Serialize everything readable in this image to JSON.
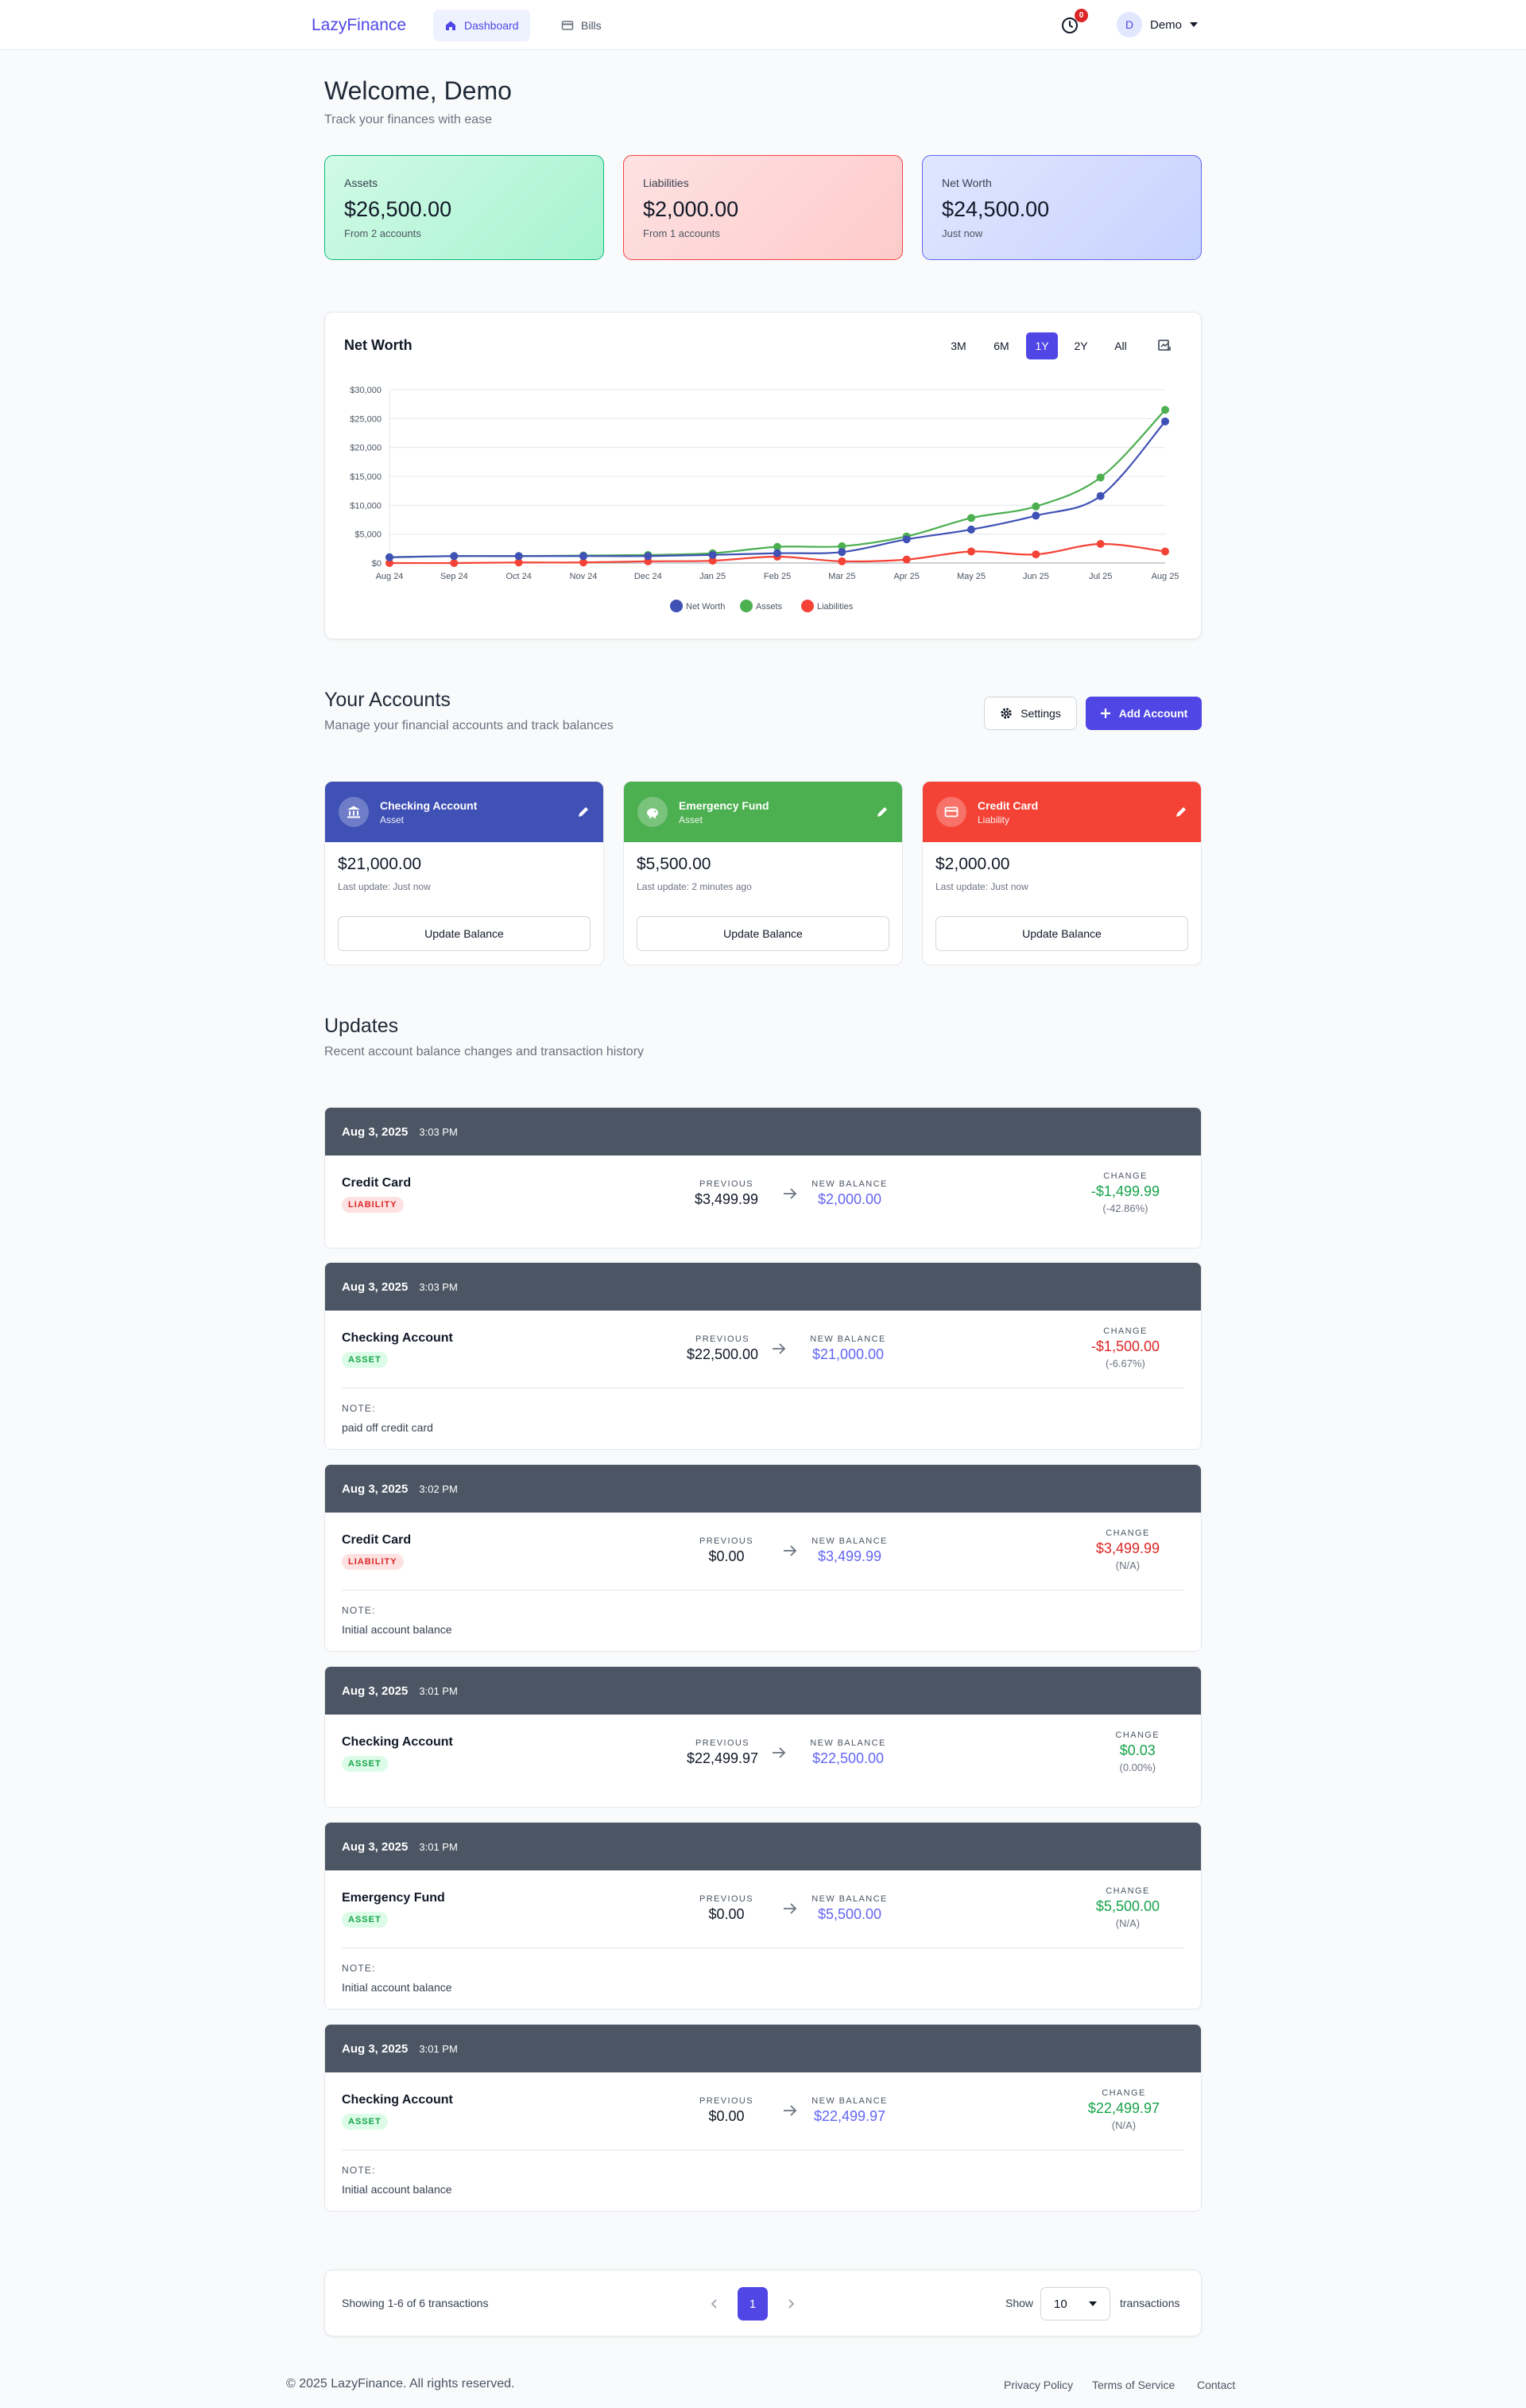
{
  "nav": {
    "logo": "LazyFinance",
    "links": [
      {
        "label": "Dashboard",
        "active": true
      },
      {
        "label": "Bills",
        "active": false
      }
    ],
    "notification_count": "0",
    "user_initial": "D",
    "user_name": "Demo"
  },
  "header": {
    "title": "Welcome, Demo",
    "subtitle": "Track your finances with ease"
  },
  "stats": [
    {
      "label": "Assets",
      "value": "$26,500.00",
      "hint": "From 2 accounts",
      "color": "#10b981"
    },
    {
      "label": "Liabilities",
      "value": "$2,000.00",
      "hint": "From 1 accounts",
      "color": "#ef4444"
    },
    {
      "label": "Net Worth",
      "value": "$24,500.00",
      "hint": "Just now",
      "color": "#6366f1"
    }
  ],
  "chart": {
    "title": "Net Worth",
    "ranges": [
      "3M",
      "6M",
      "1Y",
      "2Y",
      "All"
    ],
    "selected_range": "1Y"
  },
  "chart_data": {
    "type": "line",
    "title": "Net Worth",
    "categories": [
      "Aug 24",
      "Sep 24",
      "Oct 24",
      "Nov 24",
      "Dec 24",
      "Jan 25",
      "Feb 25",
      "Mar 25",
      "Apr 25",
      "May 25",
      "Jun 25",
      "Jul 25",
      "Aug 25"
    ],
    "ylim": [
      0,
      30000
    ],
    "yticks": [
      "$0",
      "$5,000",
      "$10,000",
      "$15,000",
      "$20,000",
      "$25,000",
      "$30,000"
    ],
    "grid": true,
    "legend_position": "bottom",
    "series": [
      {
        "name": "Net Worth",
        "color": "#3f51b5",
        "values": [
          1000,
          1200,
          1200,
          1200,
          1200,
          1400,
          1700,
          1900,
          4100,
          5800,
          8200,
          11600,
          24500
        ]
      },
      {
        "name": "Assets",
        "color": "#4caf50",
        "values": [
          1000,
          1200,
          1200,
          1300,
          1400,
          1700,
          2800,
          2900,
          4600,
          7800,
          9800,
          14800,
          26500
        ]
      },
      {
        "name": "Liabilities",
        "color": "#f44336",
        "values": [
          0,
          0,
          100,
          100,
          300,
          400,
          1100,
          300,
          600,
          2000,
          1500,
          3300,
          2000
        ]
      }
    ]
  },
  "accounts_section": {
    "title": "Your Accounts",
    "subtitle": "Manage your financial accounts and track balances",
    "settings_label": "Settings",
    "add_label": "Add Account"
  },
  "accounts": [
    {
      "name": "Checking Account",
      "type": "Asset",
      "balance": "$21,000.00",
      "last_update": "Last update: Just now",
      "button": "Update Balance",
      "color": "#3f51b5",
      "icon": "bank-icon"
    },
    {
      "name": "Emergency Fund",
      "type": "Asset",
      "balance": "$5,500.00",
      "last_update": "Last update: 2 minutes ago",
      "button": "Update Balance",
      "color": "#4caf50",
      "icon": "piggy-bank-icon"
    },
    {
      "name": "Credit Card",
      "type": "Liability",
      "balance": "$2,000.00",
      "last_update": "Last update: Just now",
      "button": "Update Balance",
      "color": "#f44336",
      "icon": "credit-card-icon"
    }
  ],
  "updates_section": {
    "title": "Updates",
    "subtitle": "Recent account balance changes and transaction history",
    "previous_label": "PREVIOUS",
    "new_label": "NEW BALANCE",
    "change_label": "CHANGE",
    "note_label": "NOTE:"
  },
  "updates": [
    {
      "date": "Aug 3, 2025",
      "time": "3:03 PM",
      "account": "Credit Card",
      "kind": "LIABILITY",
      "previous": "$3,499.99",
      "new_balance": "$2,000.00",
      "change": "-$1,499.99",
      "percent": "(-42.86%)",
      "change_dir": "pos",
      "note": ""
    },
    {
      "date": "Aug 3, 2025",
      "time": "3:03 PM",
      "account": "Checking Account",
      "kind": "ASSET",
      "previous": "$22,500.00",
      "new_balance": "$21,000.00",
      "change": "-$1,500.00",
      "percent": "(-6.67%)",
      "change_dir": "neg",
      "note": "paid off credit card"
    },
    {
      "date": "Aug 3, 2025",
      "time": "3:02 PM",
      "account": "Credit Card",
      "kind": "LIABILITY",
      "previous": "$0.00",
      "new_balance": "$3,499.99",
      "change": "$3,499.99",
      "percent": "(N/A)",
      "change_dir": "neg",
      "note": "Initial account balance"
    },
    {
      "date": "Aug 3, 2025",
      "time": "3:01 PM",
      "account": "Checking Account",
      "kind": "ASSET",
      "previous": "$22,499.97",
      "new_balance": "$22,500.00",
      "change": "$0.03",
      "percent": "(0.00%)",
      "change_dir": "pos",
      "note": ""
    },
    {
      "date": "Aug 3, 2025",
      "time": "3:01 PM",
      "account": "Emergency Fund",
      "kind": "ASSET",
      "previous": "$0.00",
      "new_balance": "$5,500.00",
      "change": "$5,500.00",
      "percent": "(N/A)",
      "change_dir": "pos",
      "note": "Initial account balance"
    },
    {
      "date": "Aug 3, 2025",
      "time": "3:01 PM",
      "account": "Checking Account",
      "kind": "ASSET",
      "previous": "$0.00",
      "new_balance": "$22,499.97",
      "change": "$22,499.97",
      "percent": "(N/A)",
      "change_dir": "pos",
      "note": "Initial account balance"
    }
  ],
  "pagination": {
    "summary": "Showing 1-6 of 6 transactions",
    "current_page": "1",
    "show_label": "Show",
    "page_size": "10",
    "suffix": "transactions"
  },
  "footer": {
    "copyright": "© 2025 LazyFinance. All rights reserved.",
    "links": [
      "Privacy Policy",
      "Terms of Service",
      "Contact"
    ]
  }
}
